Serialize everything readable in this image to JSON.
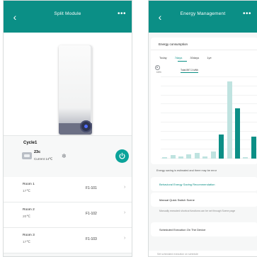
{
  "left_screen": {
    "title": "Split Module",
    "back_icon": "chevron-left-icon",
    "more_icon": "more-dots-icon",
    "control": {
      "mode_label": "Cycle1",
      "set_temp": "23c",
      "current_temp": "Current 14℃",
      "settings_icon": "gear-icon",
      "power_icon": "power-icon",
      "accent_color": "#0ba39a"
    },
    "rooms": [
      {
        "name": "Room 1",
        "temp": "17℃",
        "code": "F1-101"
      },
      {
        "name": "Room 2",
        "temp": "20℃",
        "code": "F1-102"
      },
      {
        "name": "Room 3",
        "temp": "17℃",
        "code": "F1-103"
      }
    ]
  },
  "right_screen": {
    "title": "Energy Management",
    "back_icon": "chevron-left-icon",
    "more_icon": "more-dots-icon",
    "energy": {
      "card_title": "Energy consumption",
      "tabs": [
        "Today",
        "7days",
        "30days",
        "1ye"
      ],
      "active_tab": 1,
      "unit": "kWh",
      "total_label": "Total 897.3 kWh"
    },
    "chart_data": {
      "type": "bar",
      "values": [
        2,
        4,
        3,
        5,
        7,
        3,
        9,
        30,
        95,
        62,
        2,
        27
      ],
      "highlight": [
        false,
        false,
        false,
        false,
        false,
        false,
        false,
        true,
        false,
        true,
        false,
        true
      ],
      "ylim": [
        0,
        100
      ]
    },
    "tips": {
      "intro": "Energy saving is estimated and there may be error",
      "section1": "Behavioral Energy Saving Recommendation",
      "section2": "Manual Quick Switch Scene",
      "section2_sub": "Manually executed shortcut functions can be set through Scene page",
      "section3": "Scheduled Execution On The Device",
      "bottom": "Set scheduled execution on schedule"
    },
    "brand_color": "#0b8f86"
  }
}
